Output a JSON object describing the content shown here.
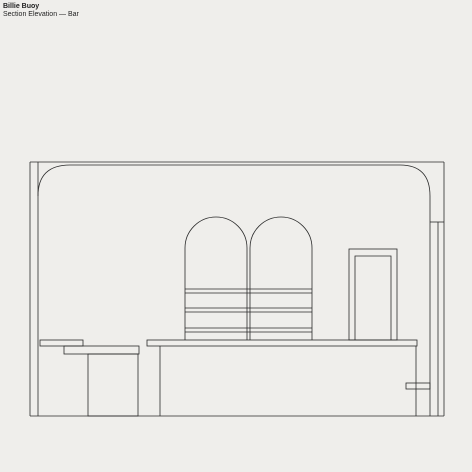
{
  "header": {
    "project": "Billie Buoy",
    "subtitle": "Section Elevation — Bar"
  },
  "colors": {
    "background": "#efeeeb",
    "linework": "#2a2a2a"
  }
}
